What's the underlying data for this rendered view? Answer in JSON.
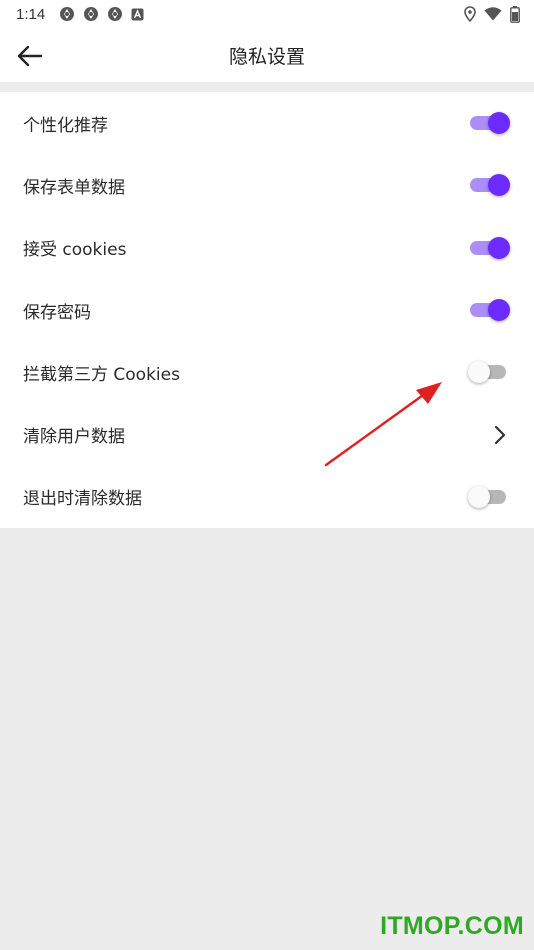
{
  "status_bar": {
    "time": "1:14",
    "left_icons": [
      "sync-icon",
      "sync-icon",
      "sync-icon",
      "a-badge-icon"
    ],
    "right_icons": [
      "location-icon",
      "wifi-icon",
      "battery-icon"
    ]
  },
  "app_bar": {
    "back_icon": "arrow-left-icon",
    "title": "隐私设置"
  },
  "settings": [
    {
      "label": "个性化推荐",
      "control": "switch",
      "on": true
    },
    {
      "label": "保存表单数据",
      "control": "switch",
      "on": true
    },
    {
      "label": "接受 cookies",
      "control": "switch",
      "on": true
    },
    {
      "label": "保存密码",
      "control": "switch",
      "on": true
    },
    {
      "label": "拦截第三方 Cookies",
      "control": "switch",
      "on": false
    },
    {
      "label": "清除用户数据",
      "control": "chevron",
      "icon": "chevron-right-icon"
    },
    {
      "label": "退出时清除数据",
      "control": "switch",
      "on": false
    }
  ],
  "colors": {
    "accent": "#6c2cff",
    "accent_track": "#ab8ff7",
    "off_track": "#b7b7b7",
    "background": "#ececec",
    "annotation_arrow": "#e02020",
    "watermark": "#2fa824"
  },
  "watermark": "ITMOP.COM"
}
